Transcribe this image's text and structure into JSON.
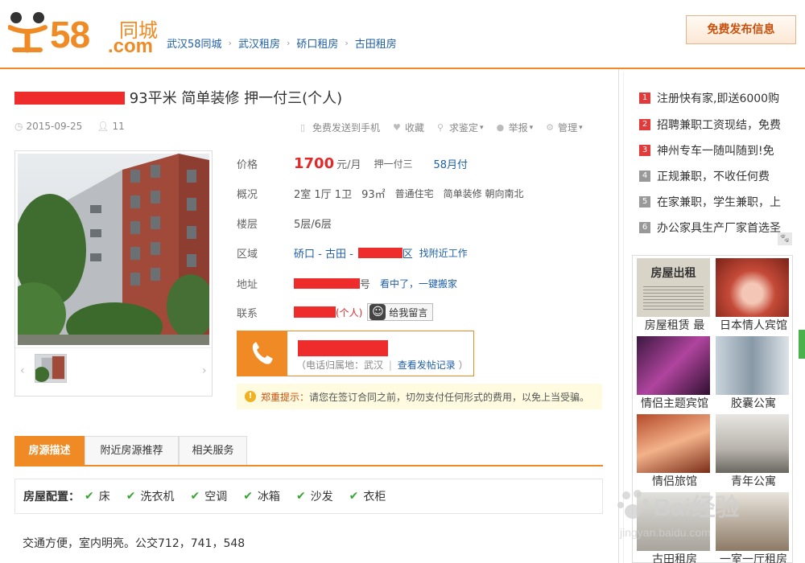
{
  "header": {
    "logo": {
      "num": "58",
      "com": ".com",
      "city": "同城"
    },
    "breadcrumb": [
      "武汉58同城",
      "武汉租房",
      "硚口租房",
      "古田租房"
    ],
    "post_button": "免费发布信息"
  },
  "listing": {
    "title_rest": "93平米 简单装修 押一付三(个人)",
    "date": "2015-09-25",
    "views": "11",
    "actions": [
      "免费发送到手机",
      "收藏",
      "求鉴定",
      "举报",
      "管理"
    ],
    "price_label": "价格",
    "price": "1700",
    "price_unit": "元/月",
    "deposit": "押一付三",
    "monthly_pay": "58月付",
    "overview_label": "概况",
    "overview": [
      "2室 1厅 1卫",
      "93㎡",
      "普通住宅",
      "简单装修 朝向南北"
    ],
    "floor_label": "楼层",
    "floor": "5层/6层",
    "area_label": "区域",
    "area": "硚口 - 古田 -",
    "area_suffix": "区",
    "nearby_jobs": "找附近工作",
    "address_label": "地址",
    "address_suffix": "号",
    "move_link": "看中了，一键搬家",
    "contact_label": "联系",
    "contact_type": "(个人)",
    "message_button": "给我留言",
    "phone_city": "（电话归属地：武汉",
    "phone_records": "查看发帖记录",
    "phone_close": "）",
    "notice_head": "郑重提示：",
    "notice_body": "请您在签订合同之前，切勿支付任何形式的费用，以免上当受骗。"
  },
  "tabs": [
    "房源描述",
    "附近房源推荐",
    "相关服务"
  ],
  "facility": {
    "label": "房屋配置：",
    "items": [
      "床",
      "洗衣机",
      "空调",
      "冰箱",
      "沙发",
      "衣柜"
    ]
  },
  "description": "交通方便，室内明亮。公交712，741，548",
  "sidebar": {
    "items": [
      {
        "n": "1",
        "text": "注册快有家,即送6000购"
      },
      {
        "n": "2",
        "text": "招聘兼职工资现结，免费"
      },
      {
        "n": "3",
        "text": "神州专车一随叫随到!免"
      },
      {
        "n": "4",
        "text": "正规兼职，不收任何费"
      },
      {
        "n": "5",
        "text": "在家兼职，学生兼职，上"
      },
      {
        "n": "6",
        "text": "办公家具生产厂家首选圣"
      }
    ],
    "ads": [
      {
        "cap": "房屋租赁 最",
        "poster": "房屋出租"
      },
      {
        "cap": "日本情人宾馆"
      },
      {
        "cap": "情侣主题宾馆"
      },
      {
        "cap": "胶囊公寓"
      },
      {
        "cap": "情侣旅馆"
      },
      {
        "cap": "青年公寓"
      },
      {
        "cap": "古田租房"
      },
      {
        "cap": "一室一厅租房"
      }
    ]
  },
  "watermark": {
    "text": "Bai经验",
    "url": "jingyan.baidu.com"
  }
}
